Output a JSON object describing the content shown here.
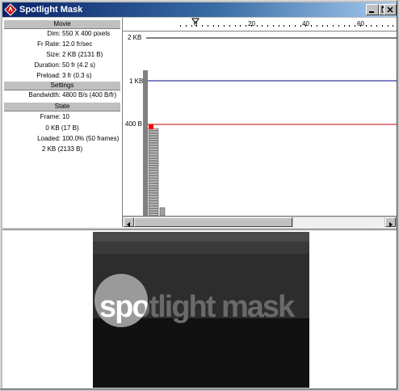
{
  "window": {
    "title": "Spotlight Mask"
  },
  "movie": {
    "header": "Movie",
    "rows": [
      {
        "label": "Dim:",
        "value": "550 X 400 pixels"
      },
      {
        "label": "Fr Rate:",
        "value": "12.0 fr/sec"
      },
      {
        "label": "Size:",
        "value": "2 KB (2131 B)"
      },
      {
        "label": "Duration:",
        "value": "50 fr (4.2 s)"
      },
      {
        "label": "Preload:",
        "value": "3 fr (0.3 s)"
      }
    ]
  },
  "settings": {
    "header": "Settings",
    "rows": [
      {
        "label": "Bandwidth:",
        "value": "4800 B/s (400 B/fr)"
      }
    ]
  },
  "state": {
    "header": "State",
    "frame_label": "Frame:",
    "frame_value": "10",
    "frame_size": "0 KB (17 B)",
    "loaded_label": "Loaded:",
    "loaded_value": "100.0% (50 frames)",
    "loaded_size": "2 KB (2133 B)"
  },
  "graph": {
    "ruler_labels": [
      "0",
      "20",
      "40",
      "60"
    ],
    "kb_labels": [
      "2 KB",
      "1 KB",
      "400 B"
    ],
    "line_colors": {
      "top": "#000000",
      "kb1": "#000080",
      "bandwidth": "#c00000"
    },
    "current_frame_color": "#ff0000"
  },
  "stage": {
    "text": "spotlight mask"
  }
}
